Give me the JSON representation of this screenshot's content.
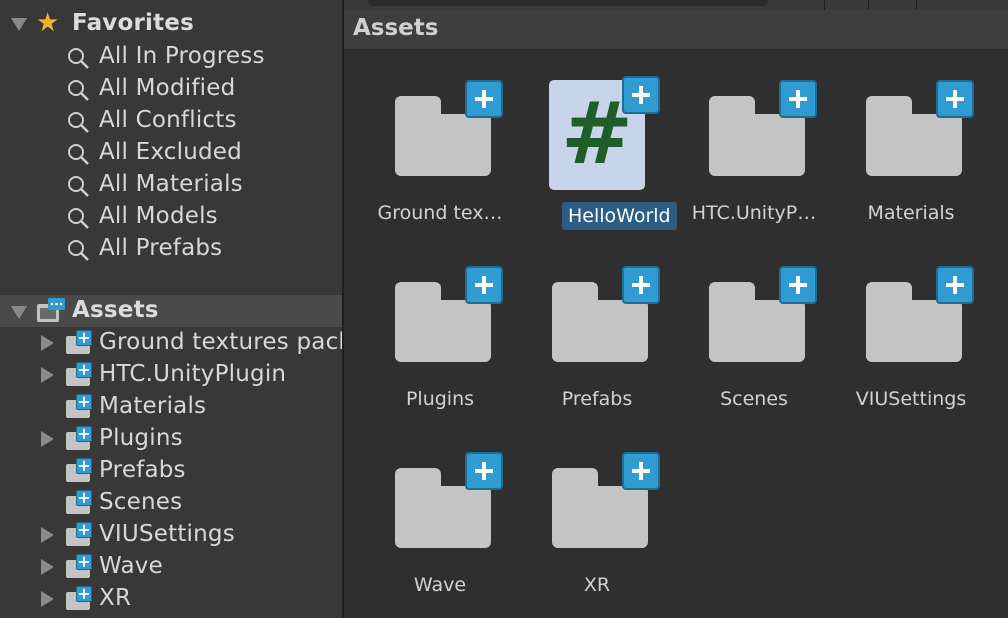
{
  "favorites": {
    "title": "Favorites",
    "items": [
      {
        "label": "All In Progress"
      },
      {
        "label": "All Modified"
      },
      {
        "label": "All Conflicts"
      },
      {
        "label": "All Excluded"
      },
      {
        "label": "All Materials"
      },
      {
        "label": "All Models"
      },
      {
        "label": "All Prefabs"
      }
    ]
  },
  "tree": {
    "root": "Assets",
    "items": [
      {
        "label": "Ground textures pack",
        "expandable": true
      },
      {
        "label": "HTC.UnityPlugin",
        "expandable": true
      },
      {
        "label": "Materials",
        "expandable": false
      },
      {
        "label": "Plugins",
        "expandable": true
      },
      {
        "label": "Prefabs",
        "expandable": false
      },
      {
        "label": "Scenes",
        "expandable": false
      },
      {
        "label": "VIUSettings",
        "expandable": true
      },
      {
        "label": "Wave",
        "expandable": true
      },
      {
        "label": "XR",
        "expandable": true
      }
    ]
  },
  "grid": {
    "breadcrumb": "Assets",
    "items": [
      {
        "label": "Ground tex…",
        "kind": "folder"
      },
      {
        "label": "HelloWorld",
        "kind": "script",
        "selected": true,
        "glyph": "#"
      },
      {
        "label": "HTC.UnityP…",
        "kind": "folder"
      },
      {
        "label": "Materials",
        "kind": "folder"
      },
      {
        "label": "Plugins",
        "kind": "folder"
      },
      {
        "label": "Prefabs",
        "kind": "folder"
      },
      {
        "label": "Scenes",
        "kind": "folder"
      },
      {
        "label": "VIUSettings",
        "kind": "folder"
      },
      {
        "label": "Wave",
        "kind": "folder"
      },
      {
        "label": "XR",
        "kind": "folder"
      }
    ]
  },
  "colors": {
    "accent_blue": "#2f9bd0",
    "selection": "#2c5d87",
    "script_bg": "#c7d4ea",
    "script_glyph": "#1f5e2a",
    "star": "#f0b429"
  }
}
